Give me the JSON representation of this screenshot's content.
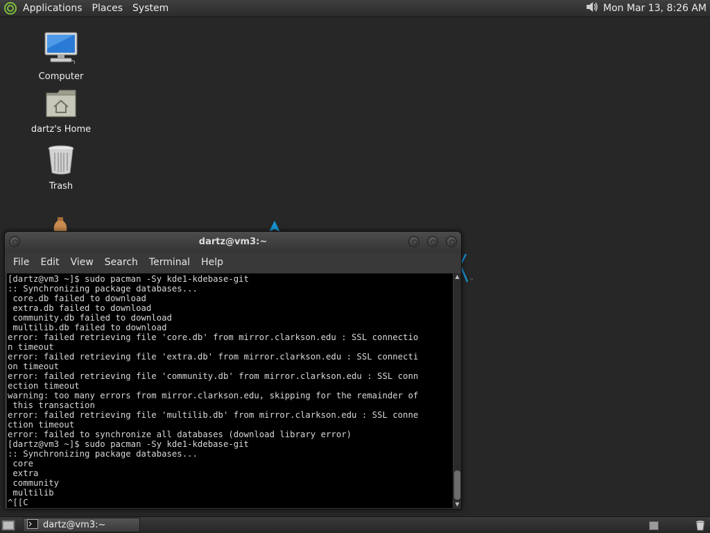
{
  "top_panel": {
    "menus": [
      "Applications",
      "Places",
      "System"
    ],
    "clock": "Mon Mar 13,  8:26 AM",
    "icons": {
      "logo": "menu-logo-icon",
      "volume": "volume-icon"
    }
  },
  "desktop": {
    "icons": [
      {
        "label": "Computer",
        "icon": "computer-icon"
      },
      {
        "label": "dartz's Home",
        "icon": "home-folder-icon"
      },
      {
        "label": "Trash",
        "icon": "trash-icon"
      }
    ]
  },
  "terminal": {
    "title": "dartz@vm3:~",
    "menu": [
      "File",
      "Edit",
      "View",
      "Search",
      "Terminal",
      "Help"
    ],
    "lines": [
      "[dartz@vm3 ~]$ sudo pacman -Sy kde1-kdebase-git",
      ":: Synchronizing package databases...",
      " core.db failed to download",
      " extra.db failed to download",
      " community.db failed to download",
      " multilib.db failed to download",
      "error: failed retrieving file 'core.db' from mirror.clarkson.edu : SSL connectio",
      "n timeout",
      "error: failed retrieving file 'extra.db' from mirror.clarkson.edu : SSL connecti",
      "on timeout",
      "error: failed retrieving file 'community.db' from mirror.clarkson.edu : SSL conn",
      "ection timeout",
      "warning: too many errors from mirror.clarkson.edu, skipping for the remainder of",
      " this transaction",
      "error: failed retrieving file 'multilib.db' from mirror.clarkson.edu : SSL conne",
      "ction timeout",
      "error: failed to synchronize all databases (download library error)",
      "[dartz@vm3 ~]$ sudo pacman -Sy kde1-kdebase-git",
      ":: Synchronizing package databases...",
      " core",
      " extra",
      " community",
      " multilib",
      "^[[C"
    ]
  },
  "bottom_panel": {
    "task_label": "dartz@vm3:~",
    "icons": {
      "show_desktop": "show-desktop-icon",
      "task": "terminal-icon",
      "trash": "trash-applet-icon"
    }
  },
  "colors": {
    "desktop_bg": "#272727",
    "panel_bg": "#333333",
    "terminal_bg": "#000000",
    "terminal_fg": "#d8d8d8"
  }
}
